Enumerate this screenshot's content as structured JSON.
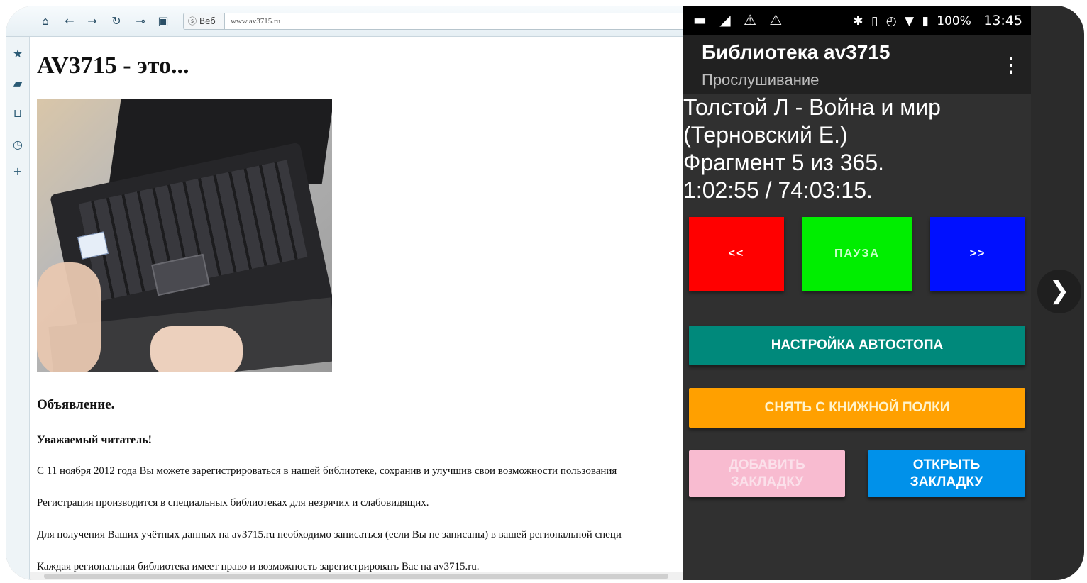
{
  "browser": {
    "toolbar": {
      "nav_icons": [
        "home-icon",
        "back-icon",
        "forward-icon",
        "refresh-icon",
        "key-icon",
        "save-icon"
      ],
      "addr_prefix": "ⓢ Веб",
      "url": "www.av3715.ru"
    },
    "sidebar_icons": [
      "star-icon",
      "bookmark-icon",
      "magnet-icon",
      "clock-icon",
      "plus-icon"
    ],
    "page": {
      "heading": "AV3715 - это...",
      "announcement_title": "Объявление.",
      "greeting": "Уважаемый читатель!",
      "paragraphs": [
        "С 11 ноября 2012 года Вы можете зарегистрироваться в нашей библиотеке, сохранив и улучшив свои возможности пользования",
        "Регистрация производится в специальных библиотеках для незрячих и слабовидящих.",
        "Для получения Ваших учётных данных на av3715.ru необходимо записаться (если Вы не записаны) в вашей региональной специ",
        "Каждая региональная библиотека имеет право и возможность зарегистрировать Вас на av3715.ru."
      ]
    }
  },
  "phone": {
    "statusbar": {
      "left_icons": "▬ ◢ ⚠ ⚠",
      "battery": "100%",
      "time": "13:45"
    },
    "appbar": {
      "title": "Библиотека av3715",
      "subtitle": "Прослушивание"
    },
    "book": {
      "author_title": "Толстой Л - Война и мир",
      "narrator": "(Терновский Е.)",
      "fragment": "Фрагмент 5 из 365.",
      "time": "1:02:55 / 74:03:15."
    },
    "controls": {
      "rewind": "<<",
      "pause": "ПАУЗА",
      "forward": ">>"
    },
    "buttons": {
      "autostop": "НАСТРОЙКА АВТОСТОПА",
      "remove_shelf": "СНЯТЬ С КНИЖНОЙ ПОЛКИ",
      "add_bookmark": "ДОБАВИТЬ\nЗАКЛАДКУ",
      "open_bookmark": "ОТКРЫТЬ\nЗАКЛАДКУ"
    },
    "colors": {
      "rewind": "#ff0000",
      "pause": "#00ee00",
      "forward": "#0010ff",
      "autostop": "#00897b",
      "remove_shelf": "#ffa000",
      "add_bookmark": "#f8bbd0",
      "open_bookmark": "#0091ea"
    }
  },
  "next_chevron": "❯"
}
